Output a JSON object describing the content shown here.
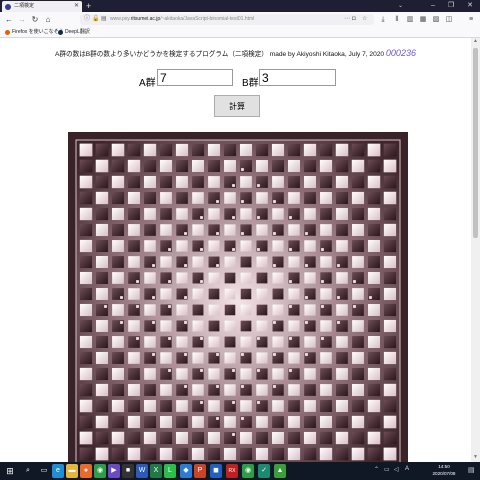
{
  "browser": {
    "tab_title": "二項検定",
    "new_tab": "+",
    "tab_list": "⌄",
    "url_prefix": "www.psy.",
    "url_host": "ritsumei.ac.jp",
    "url_path": "/~akitaoka/JavaScript-binomial-test01.html",
    "bookmarks": [
      {
        "label": "Firefox を使いこなそう",
        "color": "#e66000"
      },
      {
        "label": "DeepL翻訳",
        "color": "#0f2b46"
      }
    ]
  },
  "page": {
    "headline": "A群の数はB群の数より多いかどうかを検定するプログラム（二項検定）  made by Akiyoshi Kitaoka, July 7, 2020",
    "counter": "000236",
    "label_a": "A群",
    "value_a": "7",
    "label_b": "B群",
    "value_b": "3",
    "calc_button": "計算"
  },
  "taskbar": {
    "time": "14:50",
    "date": "2020/07/08",
    "ime": "A",
    "apps": [
      {
        "name": "search",
        "glyph": "⌕",
        "color": "transparent"
      },
      {
        "name": "task-view",
        "glyph": "▭",
        "color": "transparent"
      },
      {
        "name": "edge",
        "glyph": "e",
        "color": "#1e8fd6"
      },
      {
        "name": "explorer",
        "glyph": "▬",
        "color": "#e8b53c"
      },
      {
        "name": "firefox",
        "glyph": "●",
        "color": "#e86a2c"
      },
      {
        "name": "chrome",
        "glyph": "◉",
        "color": "#2d9e48"
      },
      {
        "name": "media",
        "glyph": "▶",
        "color": "#6a4bc4"
      },
      {
        "name": "terminal",
        "glyph": "■",
        "color": "#333"
      },
      {
        "name": "word",
        "glyph": "W",
        "color": "#2b5bb8"
      },
      {
        "name": "excel",
        "glyph": "X",
        "color": "#1f7a45"
      },
      {
        "name": "line",
        "glyph": "L",
        "color": "#2dbd4a"
      },
      {
        "name": "photos",
        "glyph": "◆",
        "color": "#2c7bd6"
      },
      {
        "name": "powerpoint",
        "glyph": "P",
        "color": "#c9452a"
      },
      {
        "name": "app-blue",
        "glyph": "◼",
        "color": "#2060c0"
      },
      {
        "name": "app-red",
        "glyph": "RX",
        "color": "#c02020"
      },
      {
        "name": "chrome2",
        "glyph": "◉",
        "color": "#2d9e48"
      },
      {
        "name": "app-teal",
        "glyph": "✓",
        "color": "#1b8a70"
      },
      {
        "name": "app-green",
        "glyph": "▲",
        "color": "#3a9e3a"
      }
    ]
  }
}
